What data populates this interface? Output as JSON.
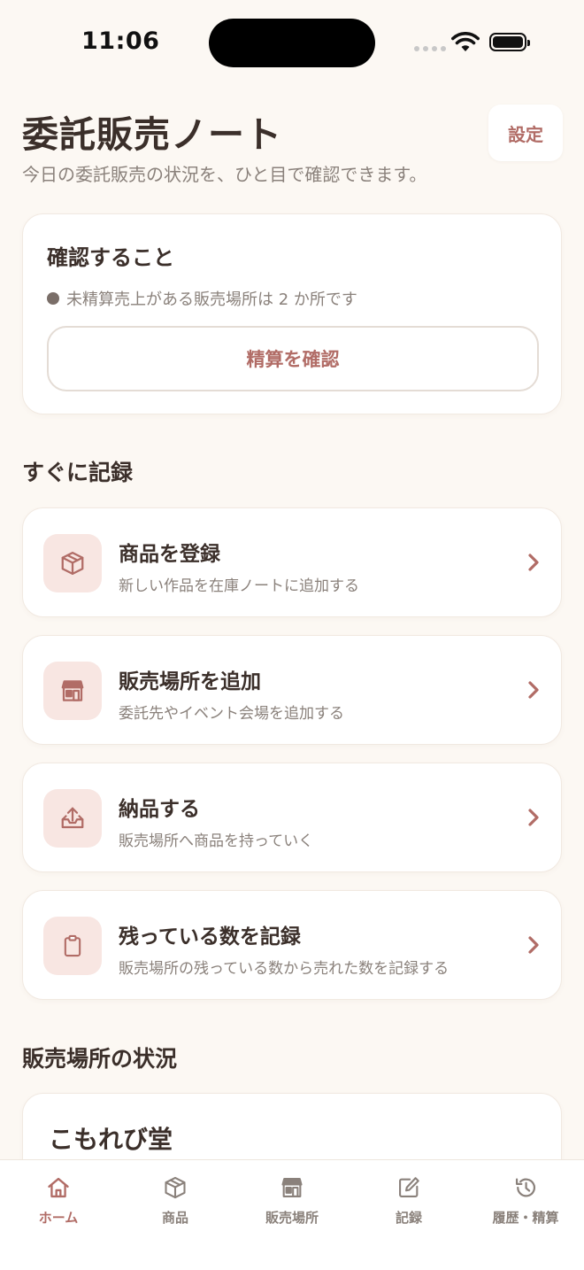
{
  "status_bar": {
    "time": "11:06"
  },
  "header": {
    "title": "委託販売ノート",
    "subtitle": "今日の委託販売の状況を、ひと目で確認できます。",
    "settings_label": "設定"
  },
  "check_card": {
    "title": "確認すること",
    "notice": "未精算売上がある販売場所は 2 か所です",
    "button_label": "精算を確認"
  },
  "quick_record": {
    "section_title": "すぐに記録",
    "items": [
      {
        "title": "商品を登録",
        "description": "新しい作品を在庫ノートに追加する",
        "icon": "box-icon"
      },
      {
        "title": "販売場所を追加",
        "description": "委託先やイベント会場を追加する",
        "icon": "store-icon"
      },
      {
        "title": "納品する",
        "description": "販売場所へ商品を持っていく",
        "icon": "delivery-tray-icon"
      },
      {
        "title": "残っている数を記録",
        "description": "販売場所の残っている数から売れた数を記録する",
        "icon": "clipboard-icon"
      }
    ]
  },
  "places": {
    "section_title": "販売場所の状況",
    "items": [
      {
        "name": "こもれび堂"
      }
    ]
  },
  "tabbar": {
    "items": [
      {
        "label": "ホーム",
        "icon": "home-icon",
        "active": true
      },
      {
        "label": "商品",
        "icon": "box-icon",
        "active": false
      },
      {
        "label": "販売場所",
        "icon": "store-icon",
        "active": false
      },
      {
        "label": "記録",
        "icon": "edit-icon",
        "active": false
      },
      {
        "label": "履歴・精算",
        "icon": "history-icon",
        "active": false
      }
    ]
  },
  "colors": {
    "background": "#fcf8f3",
    "accent": "#b16c66",
    "icon_tile": "#f8e6e2",
    "text_primary": "#3b2f2a",
    "text_secondary": "#8a817b"
  }
}
